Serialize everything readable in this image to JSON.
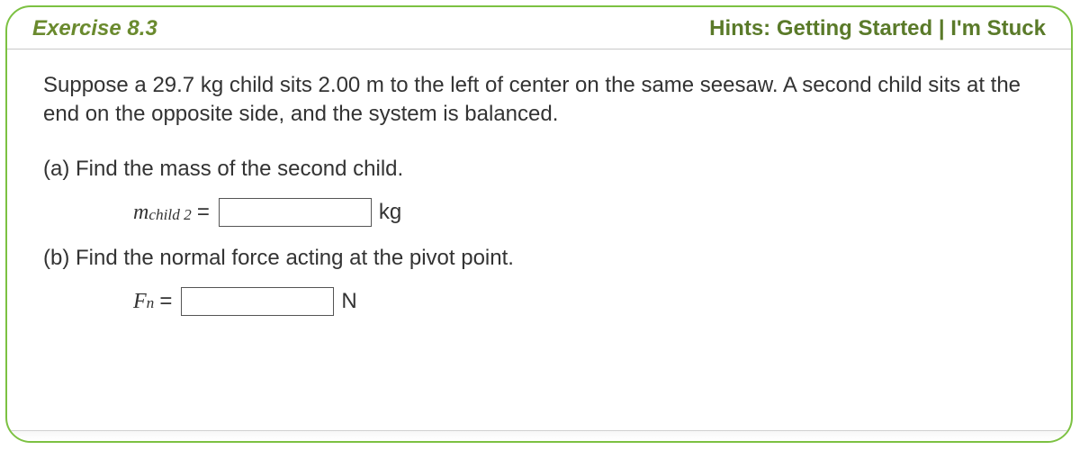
{
  "header": {
    "title": "Exercise 8.3",
    "hints_label": "Hints:",
    "getting_started": "Getting Started",
    "separator": "|",
    "im_stuck": "I'm Stuck"
  },
  "problem": {
    "text_prefix": "Suppose a ",
    "mass_value": "29.7",
    "mass_unit": " kg child sits ",
    "distance_value": "2.00",
    "text_suffix": " m to the left of center on the same seesaw. A second child sits at the end on the opposite side, and the system is balanced."
  },
  "part_a": {
    "label": "(a) Find the mass of the second child.",
    "var_main": "m",
    "var_sub": "child 2",
    "equals": "=",
    "unit": "kg"
  },
  "part_b": {
    "label": "(b) Find the normal force acting at the pivot point.",
    "var_main": "F",
    "var_sub": "n",
    "equals": "=",
    "unit": "N"
  }
}
